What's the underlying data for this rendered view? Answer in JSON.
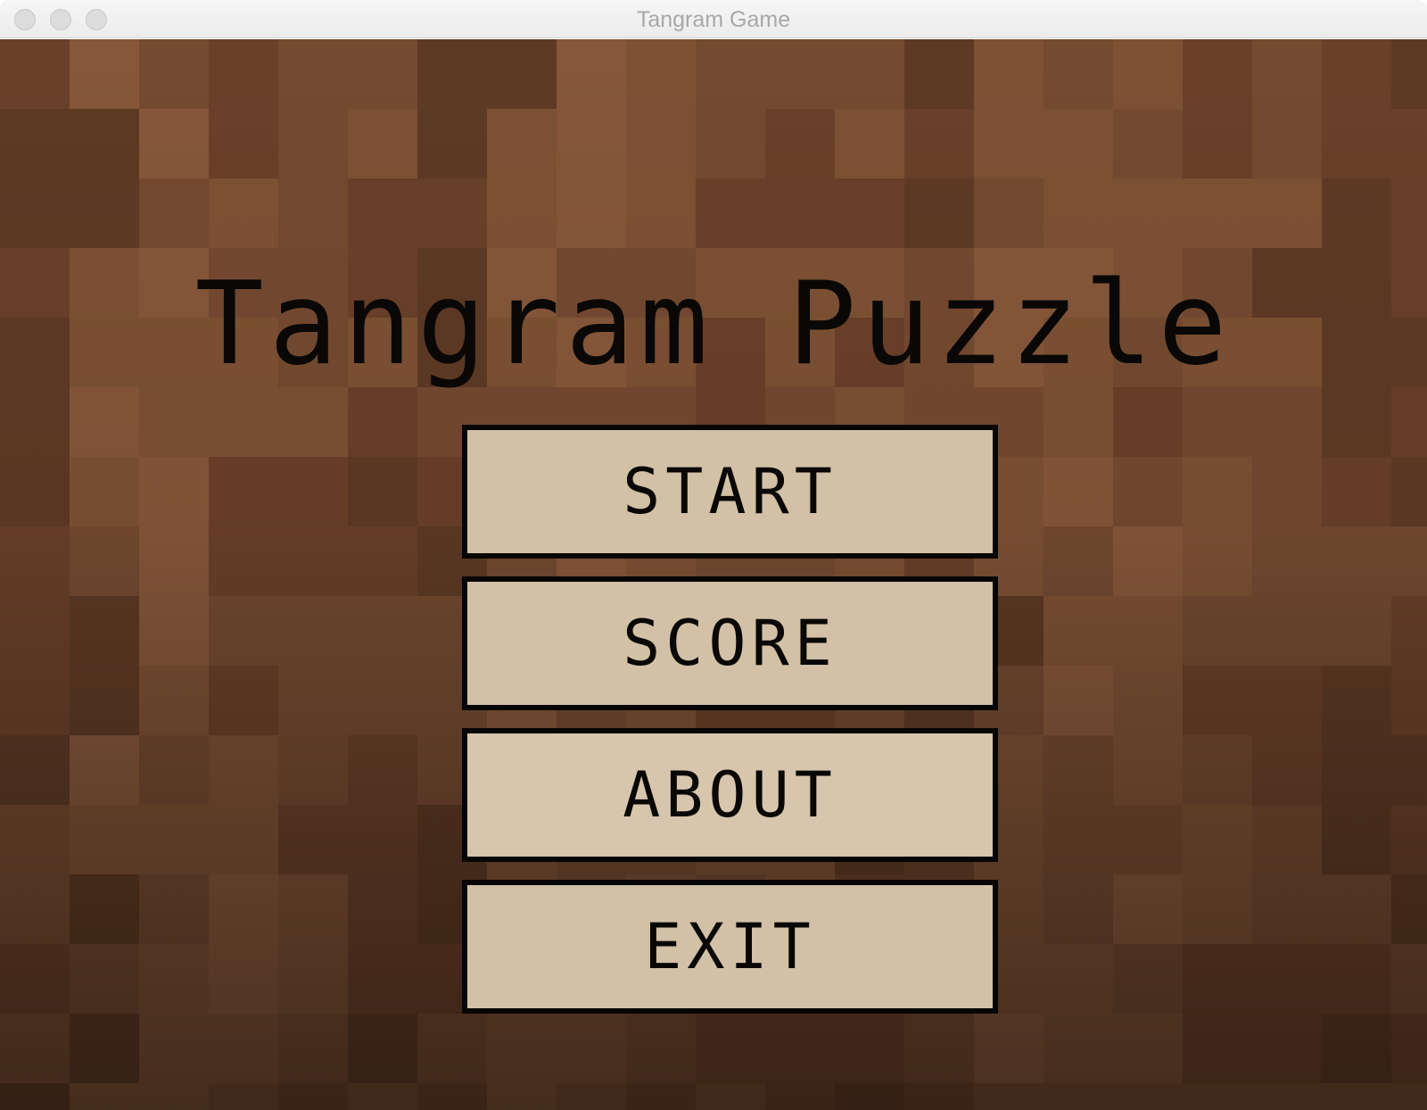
{
  "window": {
    "title": "Tangram Game"
  },
  "screen": {
    "title": "Tangram Puzzle",
    "buttons": [
      {
        "label": "START"
      },
      {
        "label": "SCORE"
      },
      {
        "label": "ABOUT"
      },
      {
        "label": "EXIT"
      }
    ]
  },
  "colors": {
    "button_fill": "#d2c1a6",
    "button_border": "#080604",
    "text": "#0a0806",
    "wood_palette": [
      "#5e3a24",
      "#6a4029",
      "#744a30",
      "#7d5134",
      "#86573a",
      "#4e3120",
      "#3e281b",
      "#33231a"
    ]
  },
  "icons": [
    "close-button",
    "minimize-button",
    "zoom-button"
  ]
}
